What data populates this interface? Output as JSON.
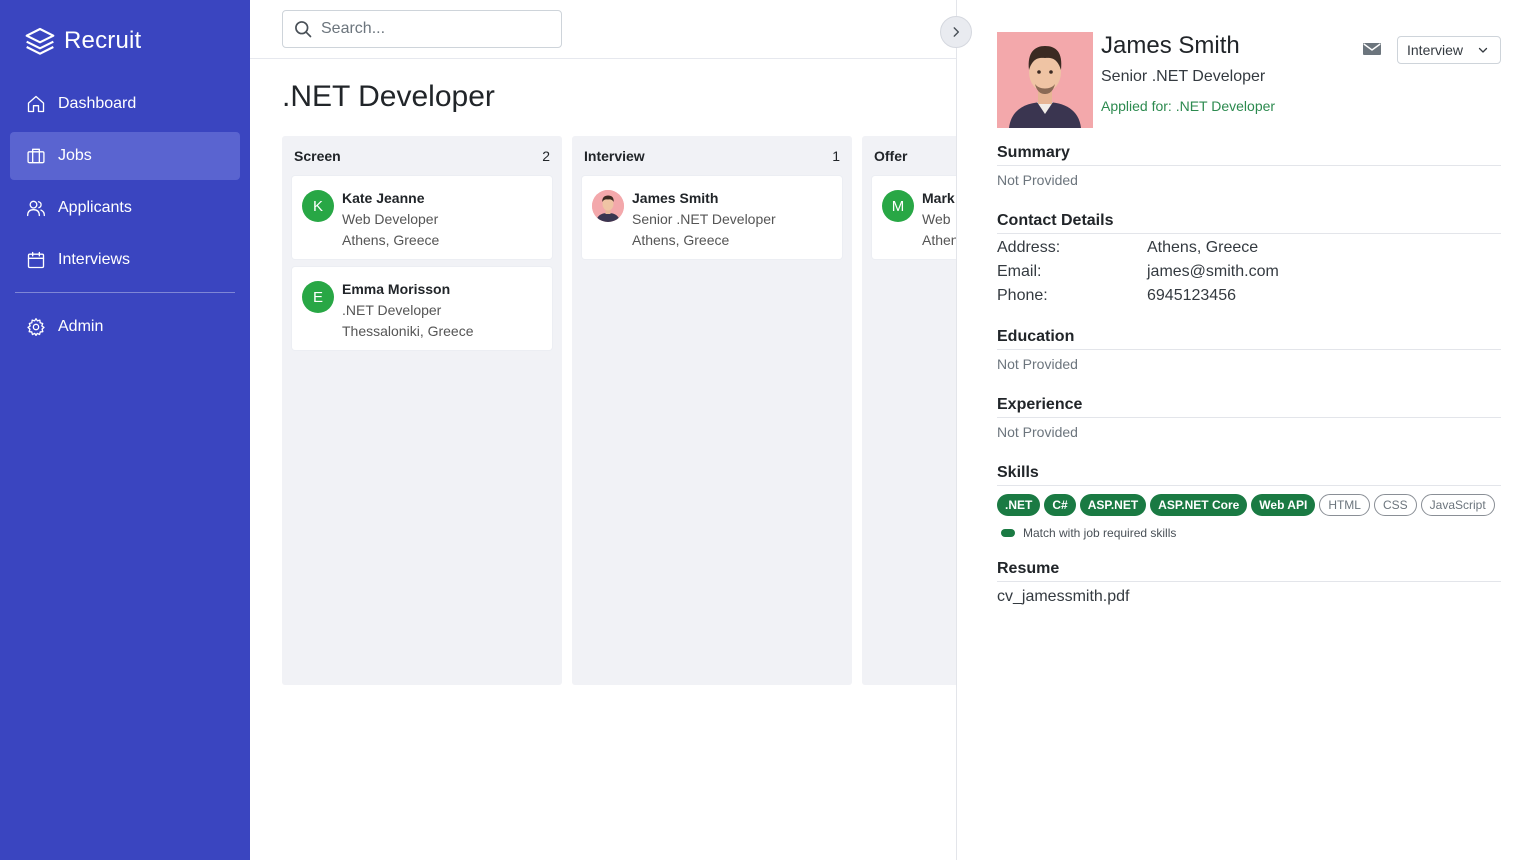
{
  "app": {
    "name": "Recruit"
  },
  "nav": {
    "items": [
      {
        "label": "Dashboard",
        "icon": "home-icon"
      },
      {
        "label": "Jobs",
        "icon": "briefcase-icon",
        "active": true
      },
      {
        "label": "Applicants",
        "icon": "users-icon"
      },
      {
        "label": "Interviews",
        "icon": "calendar-icon"
      }
    ],
    "admin": {
      "label": "Admin",
      "icon": "gear-icon"
    }
  },
  "search": {
    "placeholder": "Search..."
  },
  "page": {
    "title": ".NET Developer"
  },
  "board": {
    "columns": [
      {
        "title": "Screen",
        "count": "2",
        "cards": [
          {
            "initial": "K",
            "name": "Kate Jeanne",
            "role": "Web Developer",
            "location": "Athens, Greece"
          },
          {
            "initial": "E",
            "name": "Emma Morisson",
            "role": ".NET Developer",
            "location": "Thessaloniki, Greece"
          }
        ]
      },
      {
        "title": "Interview",
        "count": "1",
        "cards": [
          {
            "initial": "",
            "photo": true,
            "name": "James Smith",
            "role": "Senior .NET Developer",
            "location": "Athens, Greece"
          }
        ]
      },
      {
        "title": "Offer",
        "count": "",
        "cards": [
          {
            "initial": "M",
            "name": "Mark",
            "role": "Web",
            "location": "Athens"
          }
        ]
      }
    ]
  },
  "applicant": {
    "name": "James Smith",
    "title": "Senior .NET Developer",
    "applied_for": "Applied for: .NET Developer",
    "status": "Interview",
    "summary": {
      "heading": "Summary",
      "text": "Not Provided"
    },
    "contact": {
      "heading": "Contact Details",
      "address_label": "Address:",
      "address": "Athens, Greece",
      "email_label": "Email:",
      "email": "james@smith.com",
      "phone_label": "Phone:",
      "phone": "6945123456"
    },
    "education": {
      "heading": "Education",
      "text": "Not Provided"
    },
    "experience": {
      "heading": "Experience",
      "text": "Not Provided"
    },
    "skills": {
      "heading": "Skills",
      "items": [
        {
          "label": ".NET",
          "match": true
        },
        {
          "label": "C#",
          "match": true
        },
        {
          "label": "ASP.NET",
          "match": true
        },
        {
          "label": "ASP.NET Core",
          "match": true
        },
        {
          "label": "Web API",
          "match": true
        },
        {
          "label": "HTML",
          "match": false
        },
        {
          "label": "CSS",
          "match": false
        },
        {
          "label": "JavaScript",
          "match": false
        }
      ],
      "legend": "Match with job required skills"
    },
    "resume": {
      "heading": "Resume",
      "file": "cv_jamessmith.pdf"
    }
  },
  "colors": {
    "sidebar": "#3a45c0",
    "sidebar_active": "#5a64d0",
    "avatar_green": "#28a745",
    "skill_match": "#1a7a43",
    "applied_text": "#2c8a4f"
  }
}
